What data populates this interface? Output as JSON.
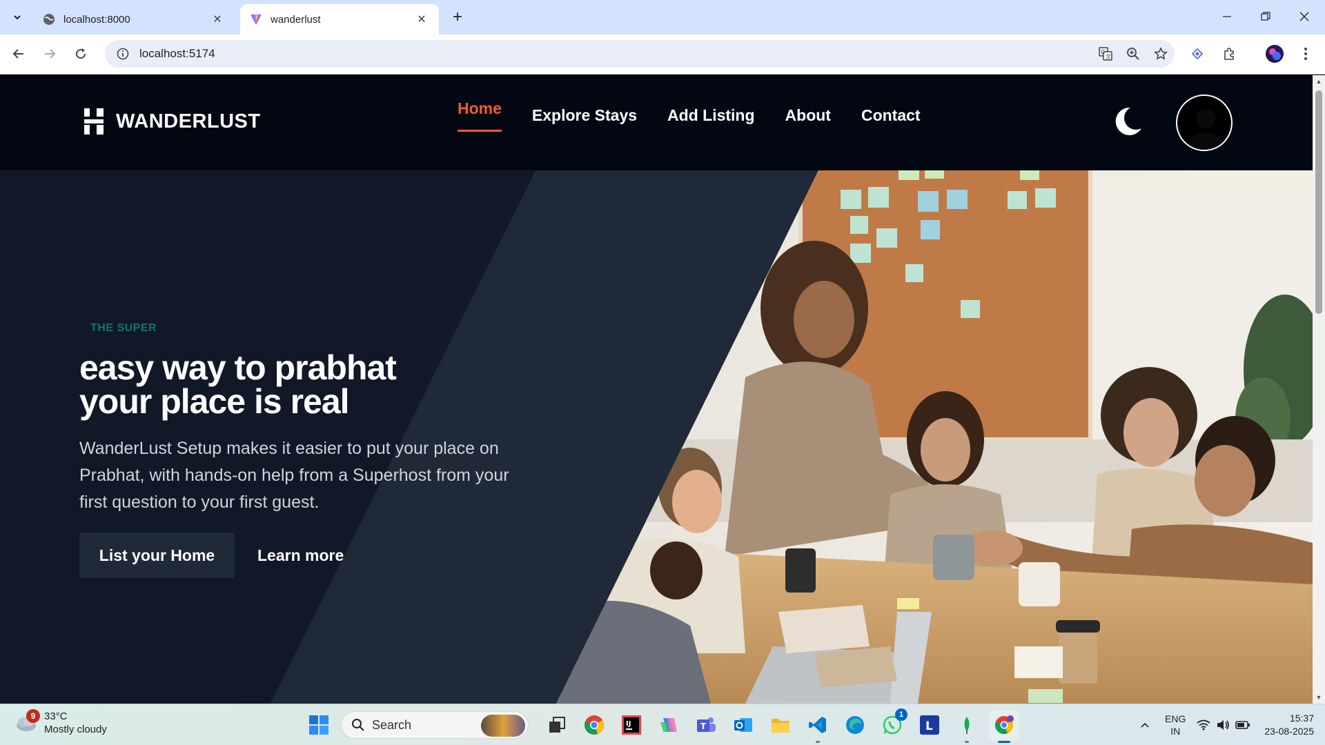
{
  "browser": {
    "tabs": [
      {
        "title": "localhost:8000",
        "active": false
      },
      {
        "title": "wanderlust",
        "active": true
      }
    ],
    "url": "localhost:5174"
  },
  "header": {
    "brand": "WANDERLUST",
    "nav": [
      {
        "label": "Home",
        "active": true
      },
      {
        "label": "Explore Stays",
        "active": false
      },
      {
        "label": "Add Listing",
        "active": false
      },
      {
        "label": "About",
        "active": false
      },
      {
        "label": "Contact",
        "active": false
      }
    ]
  },
  "hero": {
    "eyebrow": "THE SUPER",
    "title_line1": "easy way to prabhat",
    "title_line2": "your place is real",
    "description": "WanderLust Setup makes it easier to put your place on Prabhat, with hands-on help from a Superhost from your first question to your first guest.",
    "primary_button": "List your Home",
    "secondary_button": "Learn more"
  },
  "taskbar": {
    "weather_badge": "9",
    "temperature": "33°C",
    "condition": "Mostly cloudy",
    "search_label": "Search",
    "whatsapp_badge": "1",
    "lang_line1": "ENG",
    "lang_line2": "IN",
    "time": "15:37",
    "date": "23-08-2025"
  },
  "colors": {
    "accent": "#f25c2b",
    "header_bg": "#030712",
    "hero_bg": "#111827",
    "eyebrow": "#0f766e"
  }
}
